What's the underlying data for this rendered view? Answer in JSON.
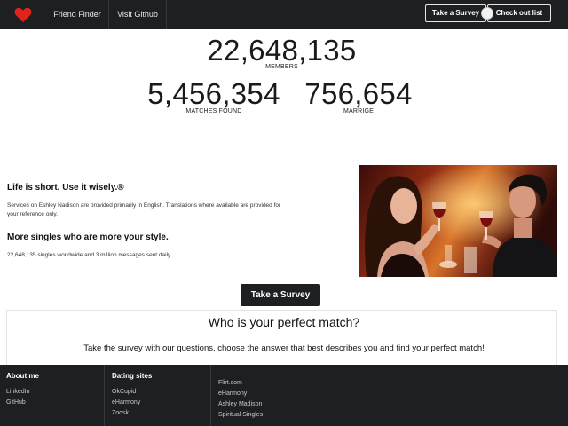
{
  "navbar": {
    "links": [
      "Friend Finder",
      "Visit Github"
    ],
    "take_survey_label": "Take a Survey",
    "check_list_label": "Check out list",
    "brand_icon": "heart-icon",
    "brand_color": "#e0241b",
    "bg_color": "#1d1f21"
  },
  "stats": {
    "members": {
      "value": "22,648,135",
      "label": "MEMBERS"
    },
    "matches": {
      "value": "5,456,354",
      "label": "MATCHES FOUND"
    },
    "marriage": {
      "value": "756,654",
      "label": "MARRIGE"
    }
  },
  "info": {
    "heading1": "Life is short. Use it wisely.®",
    "text1": "Services on Eshley Nadison are provided primarily in English. Translations where available are provided for your reference only.",
    "heading2": "More singles who are more your style.",
    "text2": "22,648,135 singles worldwide and 3 million messages sent daily."
  },
  "cta": {
    "label": "Take a Survey"
  },
  "survey_panel": {
    "title": "Who is your perfect match?",
    "text": "Take the survey with our questions, choose the answer that best describes you and find your perfect match!"
  },
  "footer": {
    "about": {
      "title": "About me",
      "links": [
        "LinkedIn",
        "GitHub"
      ]
    },
    "dating": {
      "title": "Dating sites",
      "links": [
        "OkCupid",
        "eHarmony",
        "Zoosk"
      ]
    },
    "more": {
      "links": [
        "Flirt.com",
        "eHarmony",
        "Ashley Madison",
        "Spiritual Singles"
      ]
    }
  }
}
